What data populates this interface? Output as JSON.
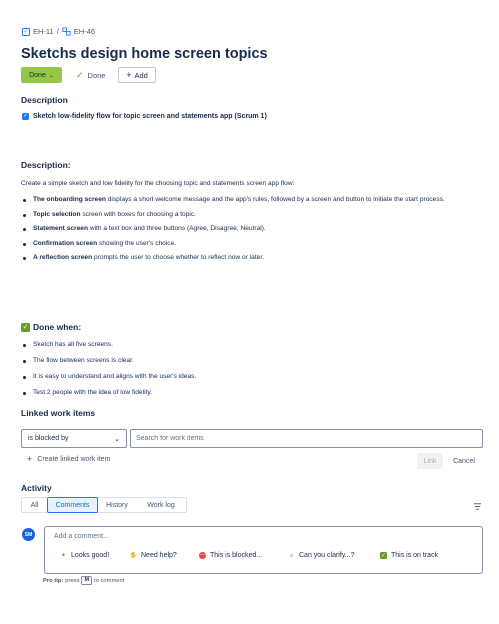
{
  "breadcrumb": {
    "parent": "EH-11",
    "separator": "/",
    "current": "EH-46"
  },
  "issue": {
    "title": "Sketchs design home screen topics"
  },
  "status": {
    "label": "Done",
    "resolution": "Done",
    "add_label": "Add"
  },
  "description_heading": "Description",
  "task": {
    "label": "Sketch low-fidelity flow for topic screen and statements app (Scrum 1)"
  },
  "body": {
    "heading": "Description:",
    "intro": "Create a simple sketch and low fidelity for the choosing topic and statements screen app flow:",
    "items": [
      {
        "bold": "The onboarding screen",
        "rest": " displays a short welcome message and the app's rules, followed by a screen and button to initiate the start process."
      },
      {
        "bold": "Topic selection",
        "rest": " screen with boxes for choosing a topic."
      },
      {
        "bold": "Statement screen",
        "rest": " with a text box and three buttons (Agree, Disagree, Neutral)."
      },
      {
        "bold": "Confirmation screen",
        "rest": " showing the user's choice."
      },
      {
        "bold": "A reflection screen",
        "rest": " prompts the user to choose whether to reflect now or later."
      }
    ],
    "done_heading": "Done when:",
    "done_items": [
      "Sketch has all five screens.",
      "The flow between screens is clear.",
      "It is easy to understand and aligns with the user's ideas.",
      "Test 2 people with the idea of low fidelity."
    ]
  },
  "linked": {
    "heading": "Linked work items",
    "relation": "is blocked by",
    "search_placeholder": "Search for work items",
    "create_label": "Create linked work item",
    "link_label": "Link",
    "cancel_label": "Cancel"
  },
  "activity": {
    "heading": "Activity",
    "tabs": [
      "All",
      "Comments",
      "History",
      "Work log"
    ],
    "active_tab": "Comments",
    "avatar_initials": "SM",
    "comment_placeholder": "Add a comment...",
    "quick_replies": [
      "Looks good!",
      "Need help?",
      "This is blocked...",
      "Can you clarify...?",
      "This is on track"
    ],
    "protip_prefix": "Pro tip:",
    "protip_press": "press",
    "protip_key": "M",
    "protip_suffix": "to comment"
  },
  "colors": {
    "accent": "#1d7afc",
    "done_green": "#94c748",
    "text": "#172b4d"
  }
}
